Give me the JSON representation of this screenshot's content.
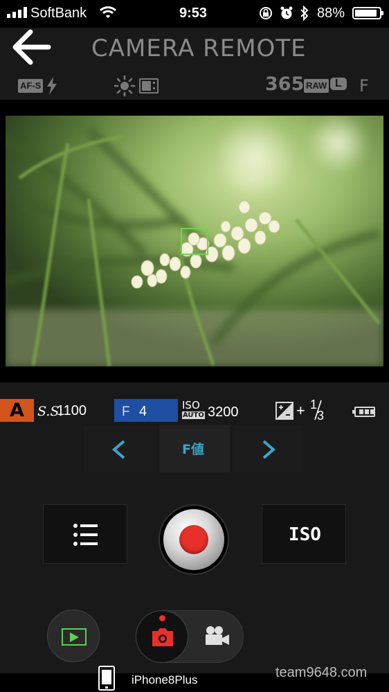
{
  "status": {
    "carrier": "SoftBank",
    "time": "9:53",
    "battery_pct": "88%"
  },
  "header": {
    "title": "CAMERA REMOTE",
    "af_mode": "AF-S",
    "shots_remaining": "365",
    "raw_label": "RAW",
    "size_label": "L",
    "quality_label": "F"
  },
  "exposure": {
    "mode": "A",
    "ss_label": "S.S.",
    "ss_value": "1100",
    "f_label": "F",
    "f_value": "4",
    "iso_label": "ISO",
    "iso_sub": "AUTO",
    "iso_value": "3200",
    "ev_sign": "+",
    "ev_num": "1",
    "ev_den": "3"
  },
  "selector": {
    "label": "F値"
  },
  "controls": {
    "iso_button": "ISO"
  },
  "footer": {
    "device_name": "iPhone8Plus",
    "watermark": "team9648.com"
  },
  "colors": {
    "mode_badge": "#d4551c",
    "f_highlight": "#1f4fa3",
    "focus_box": "#6ad84a",
    "record": "#e8302a",
    "play_green": "#58d454"
  }
}
